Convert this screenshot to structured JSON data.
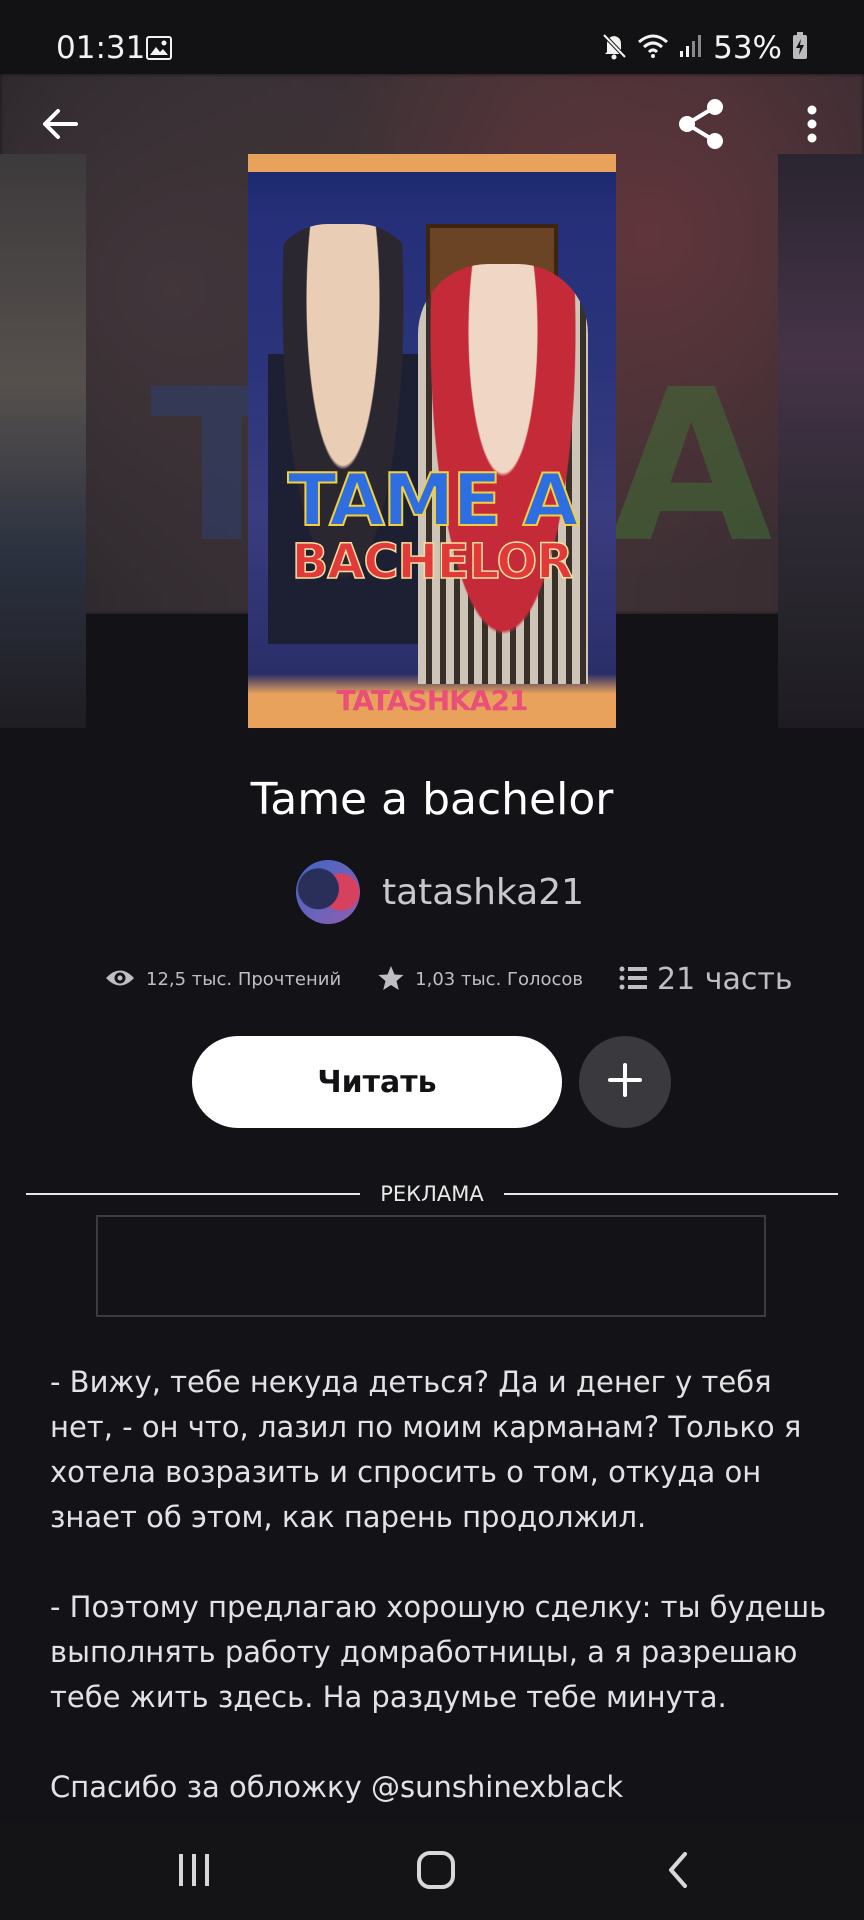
{
  "status_bar": {
    "time": "01:31",
    "battery": "53%"
  },
  "cover": {
    "title_line1": "TAME A",
    "title_line2": "BACHELOR",
    "author_mark": "TATASHKA21"
  },
  "story": {
    "title": "Tame a bachelor",
    "author": "tatashka21",
    "reads": "12,5 тыс. Прочтений",
    "votes": "1,03 тыс. Голосов",
    "parts": "21 часть"
  },
  "actions": {
    "read_label": "Читать"
  },
  "ad": {
    "label": "РЕКЛАМА"
  },
  "description": {
    "paragraph1": "- Вижу, тебе некуда деться? Да и денег у тебя нет, - он что, лазил по моим карманам? Только я хотела возразить и спросить о том, откуда он знает об этом, как парень продолжил.",
    "paragraph2": "- Поэтому предлагаю хорошую сделку: ты будешь выполнять работу домработницы, а я разрешаю тебе жить здесь. На раздумье тебе минута.",
    "paragraph3": "Спасибо за обложку @sunshinexblack"
  },
  "icons": {
    "back": "arrow-left-icon",
    "share": "share-icon",
    "more": "more-vertical-icon",
    "reads": "eye-icon",
    "votes": "star-icon",
    "parts": "list-icon",
    "add": "plus-icon"
  }
}
